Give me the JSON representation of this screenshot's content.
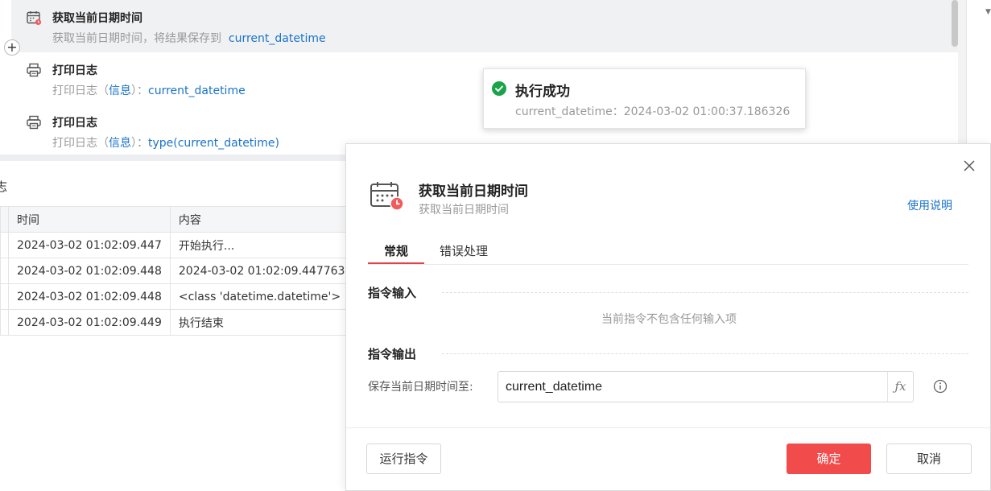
{
  "flow": {
    "items": [
      {
        "title": "获取当前日期时间",
        "desc_prefix": "获取当前日期时间，将结果保存到",
        "desc_link": "current_datetime",
        "icon": "calendar-clock-icon"
      },
      {
        "title": "打印日志",
        "desc_prefix": "打印日志（",
        "desc_level": "信息",
        "desc_sep": "）：",
        "desc_link": "current_datetime",
        "icon": "printer-icon"
      },
      {
        "title": "打印日志",
        "desc_prefix": "打印日志（",
        "desc_level": "信息",
        "desc_sep": "）：",
        "desc_link": "type(current_datetime)",
        "icon": "printer-icon"
      }
    ],
    "add_symbol": "+"
  },
  "log": {
    "label": "志",
    "columns": [
      "时间",
      "内容"
    ],
    "rows": [
      {
        "time": "2024-03-02 01:02:09.447",
        "content": "开始执行..."
      },
      {
        "time": "2024-03-02 01:02:09.448",
        "content": "2024-03-02 01:02:09.447763"
      },
      {
        "time": "2024-03-02 01:02:09.448",
        "content": "<class 'datetime.datetime'>"
      },
      {
        "time": "2024-03-02 01:02:09.449",
        "content": "执行结束"
      }
    ]
  },
  "toast": {
    "title": "执行成功",
    "message": "current_datetime：2024-03-02 01:00:37.186326",
    "icon": "check-circle-icon",
    "color": "#1aa34a"
  },
  "dialog": {
    "title": "获取当前日期时间",
    "subtitle": "获取当前日期时间",
    "help_label": "使用说明",
    "tabs": [
      "常规",
      "错误处理"
    ],
    "input_section": "指令输入",
    "input_empty": "当前指令不包含任何输入项",
    "output_section": "指令输出",
    "output_label": "保存当前日期时间至:",
    "output_value": "current_datetime",
    "fx_label": "ƒx",
    "run_button": "运行指令",
    "ok_button": "确定",
    "cancel_button": "取消",
    "accent_color": "#f24b4b",
    "link_color": "#1a73c9"
  }
}
